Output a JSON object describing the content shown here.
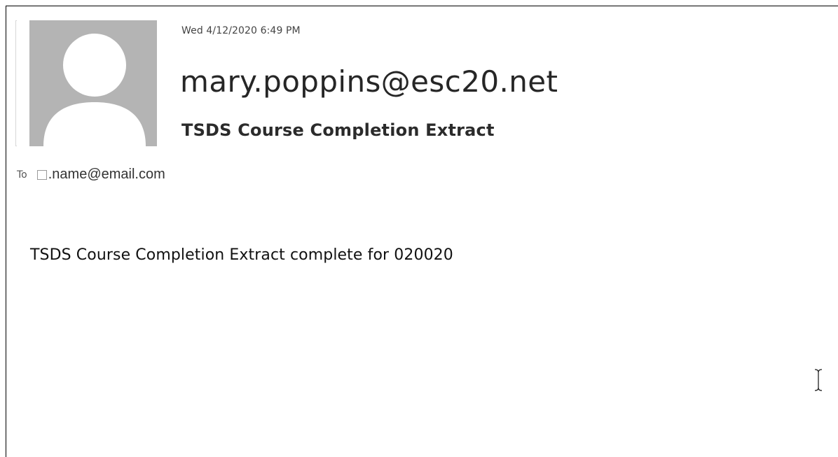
{
  "email": {
    "date": "Wed 4/12/2020 6:49 PM",
    "sender": "mary.poppins@esc20.net",
    "subject": "TSDS Course Completion Extract",
    "to_label": "To",
    "recipient": ".name@email.com",
    "body": "TSDS Course Completion Extract complete for 020020"
  },
  "icons": {
    "avatar": "user-placeholder-icon",
    "recipient_checkbox": "checkbox-icon",
    "cursor": "text-cursor-icon"
  },
  "colors": {
    "avatar_gray": "#b4b4b4",
    "text_dark": "#262626"
  }
}
